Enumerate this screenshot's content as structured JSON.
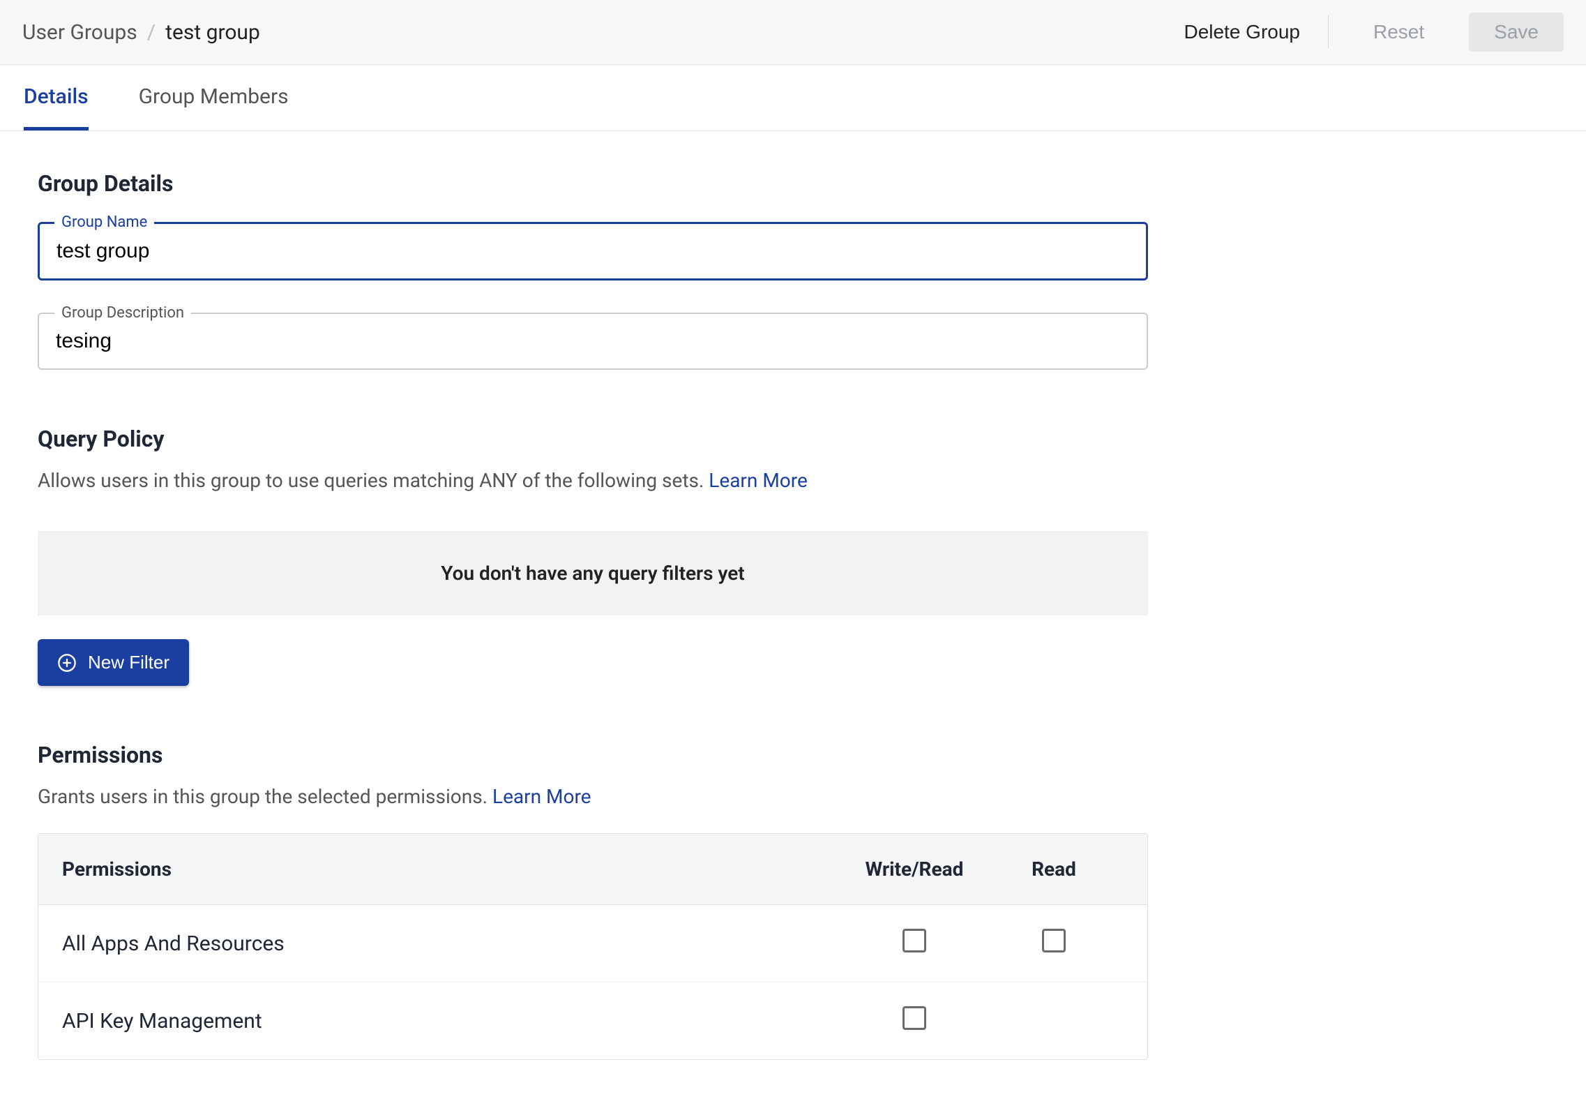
{
  "breadcrumb": {
    "root": "User Groups",
    "separator": "/",
    "leaf": "test group"
  },
  "actions": {
    "delete": "Delete Group",
    "reset": "Reset",
    "save": "Save"
  },
  "tabs": {
    "details": "Details",
    "members": "Group Members"
  },
  "group_details": {
    "heading": "Group Details",
    "name_label": "Group Name",
    "name_value": "test group",
    "desc_label": "Group Description",
    "desc_value": "tesing"
  },
  "query_policy": {
    "heading": "Query Policy",
    "subtext": "Allows users in this group to use queries matching ANY of the following sets. ",
    "learn_more": "Learn More",
    "empty": "You don't have any query filters yet",
    "new_filter": "New Filter"
  },
  "permissions": {
    "heading": "Permissions",
    "subtext": "Grants users in this group the selected permissions. ",
    "learn_more": "Learn More",
    "columns": {
      "perm": "Permissions",
      "wr": "Write/Read",
      "r": "Read"
    },
    "rows": [
      {
        "label": "All Apps And Resources",
        "write_read": false,
        "read": false,
        "has_read_col": true
      },
      {
        "label": "API Key Management",
        "write_read": false,
        "read": null,
        "has_read_col": false
      }
    ]
  }
}
